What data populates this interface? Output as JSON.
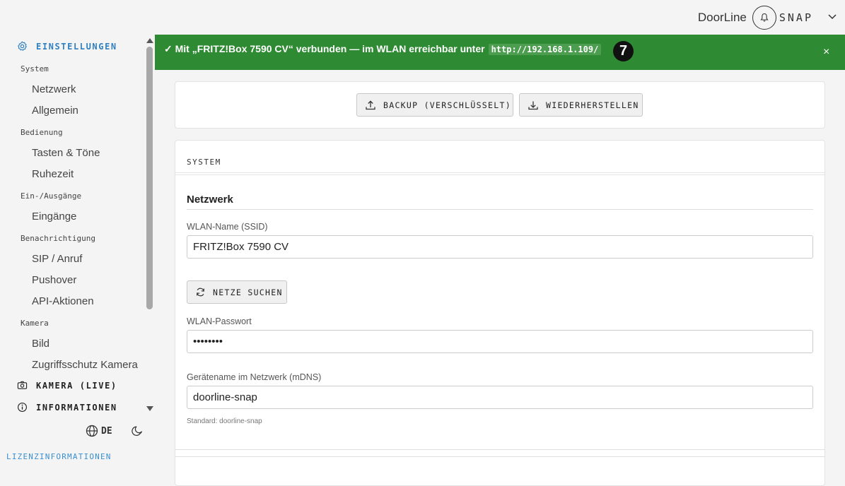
{
  "header": {
    "brand_name": "DoorLine",
    "brand_suffix": "SNAP",
    "icons": {
      "logo": "bell-icon",
      "menu": "chevron-down-icon"
    }
  },
  "sidebar": {
    "main_settings": "EINSTELLUNGEN",
    "groups": [
      {
        "label": "System",
        "items": [
          "Netzwerk",
          "Allgemein"
        ]
      },
      {
        "label": "Bedienung",
        "items": [
          "Tasten & Töne",
          "Ruhezeit"
        ]
      },
      {
        "label": "Ein-/Ausgänge",
        "items": [
          "Eingänge"
        ]
      },
      {
        "label": "Benachrichtigung",
        "items": [
          "SIP / Anruf",
          "Pushover",
          "API-Aktionen"
        ]
      },
      {
        "label": "Kamera",
        "items": [
          "Bild",
          "Zugriffsschutz Kamera"
        ]
      }
    ],
    "main_camera": "KAMERA (LIVE)",
    "main_info": "INFORMATIONEN",
    "language": "DE",
    "license": "LIZENZINFORMATIONEN",
    "accent_color": "#2f7fc1"
  },
  "banner": {
    "message": "✓ Mit „FRITZ!Box 7590 CV“ verbunden — im WLAN erreichbar unter",
    "url": "http://192.168.1.109/",
    "badge": "7",
    "close": "×",
    "color": "#2e8a33"
  },
  "actions": {
    "backup": "BACKUP (VERSCHLÜSSELT)",
    "restore": "WIEDERHERSTELLEN"
  },
  "system": {
    "title": "SYSTEM",
    "network": {
      "heading": "Netzwerk",
      "ssid_label": "WLAN-Name (SSID)",
      "ssid_value": "FRITZ!Box 7590 CV",
      "scan_button": "NETZE SUCHEN",
      "password_label": "WLAN-Passwort",
      "password_value": "••••••••",
      "hostname_label": "Gerätename im Netzwerk (mDNS)",
      "hostname_value": "doorline-snap",
      "hostname_hint": "Standard: doorline-snap"
    }
  }
}
